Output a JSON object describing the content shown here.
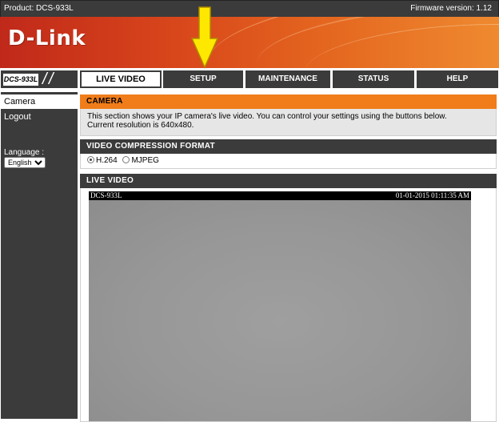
{
  "topbar": {
    "product": "Product: DCS-933L",
    "firmware": "Firmware version: 1.12"
  },
  "brand": {
    "logo": "D-Link",
    "accent": "#f07d1a",
    "dark": "#3b3b3b",
    "banner_start": "#c0291a",
    "banner_end": "#ef8a30"
  },
  "annotation": {
    "icon": "arrow-down-icon",
    "color": "#ffe800"
  },
  "nav": {
    "model": "DCS-933L",
    "tabs": [
      {
        "label": "LIVE VIDEO"
      },
      {
        "label": "SETUP"
      },
      {
        "label": "MAINTENANCE"
      },
      {
        "label": "STATUS"
      },
      {
        "label": "HELP"
      }
    ]
  },
  "sidebar": {
    "items": [
      {
        "label": "Camera"
      },
      {
        "label": "Logout"
      }
    ],
    "language_label": "Language :",
    "language_value": "English"
  },
  "camera_panel": {
    "title": "CAMERA",
    "text_line1": "This section shows your IP camera's live video. You can control your settings using the buttons below.",
    "text_line2": "Current resolution is 640x480."
  },
  "compression": {
    "title": "VIDEO COMPRESSION FORMAT",
    "options": [
      {
        "label": "H.264",
        "selected": true
      },
      {
        "label": "MJPEG",
        "selected": false
      }
    ]
  },
  "live_video": {
    "title": "LIVE VIDEO",
    "camera_name": "DCS-933L",
    "timestamp": "01-01-2015 01:11:35 AM"
  }
}
